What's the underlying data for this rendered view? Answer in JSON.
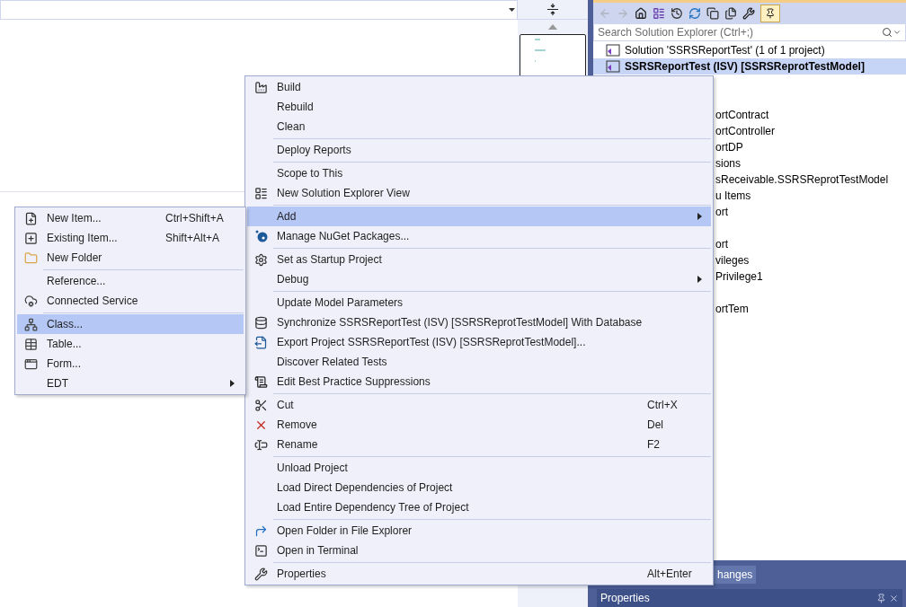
{
  "solution_explorer": {
    "search": {
      "placeholder": "Search Solution Explorer (Ctrl+;)"
    },
    "tree": [
      {
        "label": "Solution 'SSRSReportTest' (1 of 1 project)",
        "selected": false,
        "bold": false
      },
      {
        "label": "SSRSReportTest (ISV) [SSRSReprotTestModel]",
        "selected": true,
        "bold": true
      }
    ],
    "partly_hidden_rows": [
      [
        "ortContract",
        "ortController",
        "ortDP",
        "sions",
        "sReceivable.SSRSReprotTestModel",
        "u Items",
        "ort"
      ],
      [
        "ort",
        "vileges",
        "Privilege1"
      ],
      [
        "ortTem"
      ]
    ]
  },
  "bottom_tabs": [
    {
      "label": "hanges"
    }
  ],
  "properties_panel": {
    "title": "Properties"
  },
  "context_menu": {
    "groups": [
      [
        {
          "label": "Build",
          "selected": false
        },
        {
          "label": "Rebuild",
          "selected": false
        },
        {
          "label": "Clean",
          "selected": false
        }
      ],
      [
        {
          "label": "Deploy Reports",
          "selected": false
        }
      ],
      [
        {
          "label": "Scope to This",
          "selected": false
        },
        {
          "label": "New Solution Explorer View",
          "selected": false
        }
      ],
      [
        {
          "label": "Add",
          "selected": true,
          "has_submenu": true
        },
        {
          "label": "Manage NuGet Packages...",
          "selected": false
        }
      ],
      [
        {
          "label": "Set as Startup Project",
          "selected": false
        },
        {
          "label": "Debug",
          "selected": false,
          "has_submenu": true
        }
      ],
      [
        {
          "label": "Update Model Parameters",
          "selected": false
        },
        {
          "label": "Synchronize SSRSReportTest (ISV) [SSRSReprotTestModel] With Database",
          "selected": false
        },
        {
          "label": "Export Project SSRSReportTest (ISV) [SSRSReprotTestModel]...",
          "selected": false
        },
        {
          "label": "Discover Related Tests",
          "selected": false
        },
        {
          "label": "Edit Best Practice Suppressions",
          "selected": false
        }
      ],
      [
        {
          "label": "Cut",
          "shortcut": "Ctrl+X",
          "selected": false
        },
        {
          "label": "Remove",
          "shortcut": "Del",
          "selected": false
        },
        {
          "label": "Rename",
          "shortcut": "F2",
          "selected": false
        }
      ],
      [
        {
          "label": "Unload Project",
          "selected": false
        },
        {
          "label": "Load Direct Dependencies of Project",
          "selected": false
        },
        {
          "label": "Load Entire Dependency Tree of Project",
          "selected": false
        }
      ],
      [
        {
          "label": "Open Folder in File Explorer",
          "selected": false
        },
        {
          "label": "Open in Terminal",
          "selected": false
        }
      ],
      [
        {
          "label": "Properties",
          "shortcut": "Alt+Enter",
          "selected": false
        }
      ]
    ]
  },
  "add_submenu": {
    "groups": [
      [
        {
          "label": "New Item...",
          "shortcut": "Ctrl+Shift+A",
          "selected": false
        },
        {
          "label": "Existing Item...",
          "shortcut": "Shift+Alt+A",
          "selected": false
        },
        {
          "label": "New Folder",
          "selected": false
        }
      ],
      [
        {
          "label": "Reference...",
          "selected": false
        },
        {
          "label": "Connected Service",
          "selected": false
        }
      ],
      [
        {
          "label": "Class...",
          "selected": true
        },
        {
          "label": "Table...",
          "selected": false
        },
        {
          "label": "Form...",
          "selected": false
        },
        {
          "label": "EDT",
          "selected": false,
          "has_submenu": true
        }
      ]
    ]
  }
}
